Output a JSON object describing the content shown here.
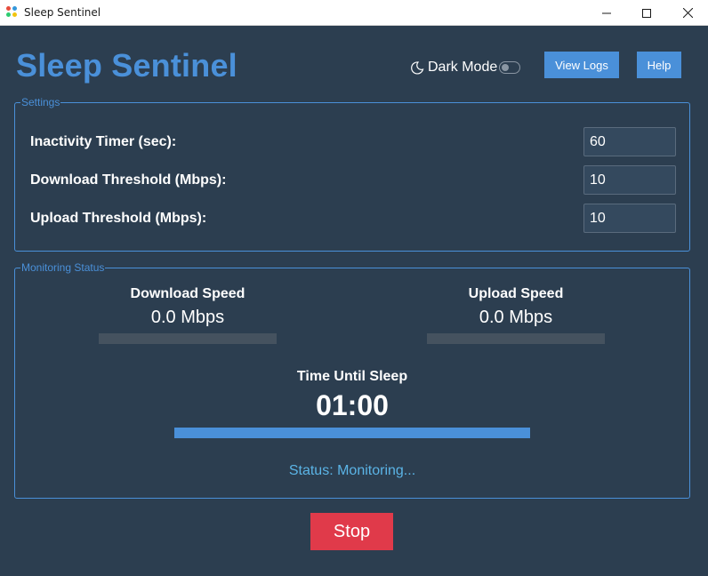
{
  "window": {
    "title": "Sleep Sentinel",
    "minimize_icon": "minimize-icon",
    "maximize_icon": "maximize-icon",
    "close_icon": "close-icon"
  },
  "header": {
    "app_title": "Sleep Sentinel",
    "dark_mode_label": "Dark Mode",
    "dark_mode_on": false,
    "view_logs_label": "View Logs",
    "help_label": "Help"
  },
  "settings": {
    "legend": "Settings",
    "rows": [
      {
        "label": "Inactivity Timer (sec):",
        "value": "60"
      },
      {
        "label": "Download Threshold (Mbps):",
        "value": "10"
      },
      {
        "label": "Upload Threshold (Mbps):",
        "value": "10"
      }
    ]
  },
  "monitoring": {
    "legend": "Monitoring Status",
    "download": {
      "label": "Download Speed",
      "value": "0.0 Mbps",
      "progress": 0
    },
    "upload": {
      "label": "Upload Speed",
      "value": "0.0 Mbps",
      "progress": 0
    },
    "sleep": {
      "label": "Time Until Sleep",
      "value": "01:00",
      "progress": 1.0
    },
    "status": "Status: Monitoring..."
  },
  "actions": {
    "stop_label": "Stop"
  },
  "colors": {
    "background": "#2c3e50",
    "accent": "#4a90d9",
    "stop": "#e03a4a",
    "status": "#5bb4e6"
  }
}
